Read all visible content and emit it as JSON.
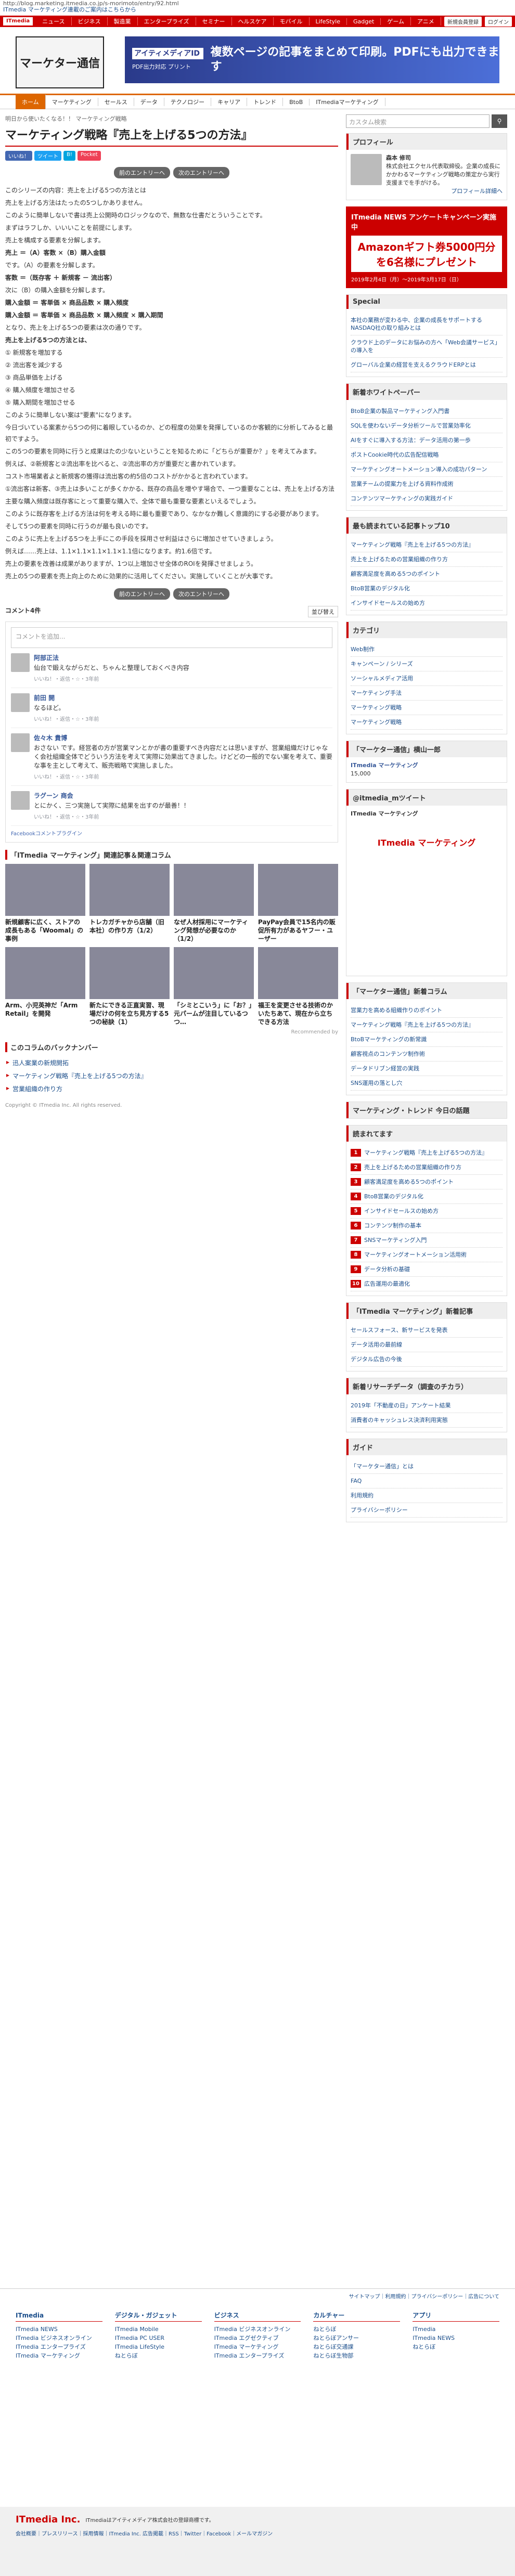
{
  "url": "http://blog.marketing.itmedia.co.jp/s-morimoto/entry/92.html",
  "url_sub": "ITmedia マーケティング連載のご案内はこちらから",
  "gnav": {
    "logo": "ITmedia",
    "items": [
      "ニュース",
      "ビジネス",
      "製造業",
      "エンタープライズ",
      "セミナー",
      "ヘルスケア",
      "モバイル",
      "LifeStyle",
      "Gadget",
      "ゲーム",
      "アニメ"
    ],
    "right": [
      "新規会員登録",
      "ログイン"
    ]
  },
  "header": {
    "logo": "マーケター通信",
    "banner_tag": "アイティメディアID",
    "banner_sub": "PDF出力対応 プリント",
    "banner_title": "複数ページの記事をまとめて印刷。PDFにも出力できます"
  },
  "nav": [
    "ホーム",
    "マーケティング",
    "セールス",
    "データ",
    "テクノロジー",
    "キャリア",
    "トレンド",
    "BtoB",
    "ITmediaマーケティング"
  ],
  "main": {
    "crumb": "明日から使いたくなる！！ マーケティング戦略",
    "title": "マーケティング戦略『売上を上げる5つの方法』",
    "share": [
      "いいね！",
      "ツイート",
      "B!",
      "Pocket"
    ],
    "pg_prev": "前のエントリーへ",
    "pg_next": "次のエントリーへ",
    "paras": [
      "このシリーズの内容：売上を上げる5つの方法とは",
      "売上を上げる方法はたったの5つしかありません。",
      "このように簡単しないで書は売上公開時のロジックなので、無数な仕書だとういうことです。",
      "まずはラフしか、いいいことを前提にします。",
      "売上を構成する要素を分解します。",
      "売上 ＝（A）客数 ×（B）購入金額",
      "です。（A）の要素を分解します。",
      "客数 ＝（既存客 ＋ 新規客 － 流出客）",
      "次に（B）の購入金額を分解します。",
      "購入金額 ＝ 客単価 × 商品品数 × 購入頻度",
      "購入金額 ＝ 客単価 × 商品品数 × 購入頻度 × 購入期間",
      "となり、売上を上げる5つの要素は次の通りです。",
      "売上を上げる5つの方法とは、",
      "① 新規客を増加する",
      "② 流出客を減少する",
      "③ 商品単価を上げる",
      "④ 購入頻度を増加させる",
      "⑤ 購入期間を増加させる",
      "このように簡単しない案は\"要素\"になります。",
      "今日づいている案素から5つの何に着眼しているのか、どの程度の効果を発揮しているのか客観的に分析してみると最初ですよう。",
      "この5つの要素を同時に行うと成果はたの少ないということを知るために「どちらが重要か？」を考えてみます。",
      "例えば、②新規客と②流出率を比べると、②流出率の方が重要だと書かれています。",
      "コスト市場業者よと新規客の獲得は流出客の約5倍のコストがかかると言われています。",
      "①流出客は新客、③売上は多いことが多くかかる、既存の商品を増やす場合で、一つ重要なことは、売上を上げる方法",
      "主要な購入頻度は既存客にとって重要な購入で、全体で最も重要な要素といえるでしょう。",
      "このように既存客を上げる方法は何を考える時に最も重要であり、なかなか難しく意識的にする必要があります。",
      "そして5つの要素を同時に行うのが最も良いのです。",
      "このように売上を上げる5つを上手にこの手段を採用させ利益はさらに増加させていきましょう。",
      "例えば……売上は、1.1×1.1×1.1×1.1×1.1倍になります。約1.6倍です。",
      "売上の要素を改善は成果がありますが、1つ以上増加させ全体のROIを発揮させましょう。",
      "売上の5つの要素を売上向上のために効果的に活用してください。実施していくことが大事です。"
    ],
    "bold_idx": [
      5,
      7,
      9,
      10,
      12
    ],
    "comments_count": "コメント4件",
    "sort": "並び替え",
    "comment_placeholder": "コメントを追加...",
    "comments": [
      {
        "name": "阿部正法",
        "text": "仙台で鍛えながらだと、ちゃんと整理しておくべき内容",
        "meta": "いいね！・返信・☆・3年前"
      },
      {
        "name": "前田 開",
        "text": "なるほど。",
        "meta": "いいね！・返信・☆・3年前"
      },
      {
        "name": "佐々木 貴博",
        "text": "おさない です。経営者の方が営業マンとかが書の重要すべき内容だとは思いますが、営業組織だけじゃなく会社組織全体でどういう方法を考えて実際に効果出てきました。けどどの一般的でない案を考えて、重要な事を主として考えて、販売戦略で実施しました。",
        "meta": "いいね！・返信・☆・3年前"
      },
      {
        "name": "ラグーン 商会",
        "text": "とにかく、三つ実施して実際に結果を出すのが最善！！",
        "meta": "いいね！・返信・☆・3年前"
      }
    ],
    "fb_plugin": "Facebookコメントプラグイン",
    "related_title": "「ITmedia マーケティング」関連記事＆関連コラム",
    "cards": [
      "新規顧客に広く、ストアの成長もある「Woomal」の事例",
      "トレカガチャから店舗（旧本社）の作り方（1/2）",
      "なぜ人材採用にマーケティング発想が必要なのか（1/2）",
      "PayPay会員で15名内の販促所有力があるヤフー・ユーザー",
      "Arm、小児英神だ「Arm Retail」を開発",
      "新たにできる正直実習、現場だけの何を立ち見方する5つの秘訣（1）",
      "「シミとこいう」に「お？」元パームが注目しているつつ…",
      "福王を変更させる技術のかいたちあて、現在から立ちできる方法"
    ],
    "recommended": "Recommended by",
    "backnumber_title": "このコラムのバックナンバー",
    "backnumbers": [
      "迅人案業の新規開拓",
      "マーケティング戦略『売上を上げる5つの方法』",
      "営業組織の作り方"
    ],
    "copyright": "Copyright © ITmedia Inc. All rights reserved."
  },
  "side": {
    "search_placeholder": "カスタム検索",
    "profile_title": "プロフィール",
    "profile_name": "森本 修司",
    "profile_text": "株式会社エクセル代表取締役。企業の成長にかかわるマーケティング戦略の策定から実行支援までを手がける。",
    "profile_more": "プロフィール詳細へ",
    "ad_title": "ITmedia NEWS アンケートキャンペーン実施中",
    "ad_prize": "Amazonギフト券5000円分を6名様にプレゼント",
    "ad_dates": "2019年2月4日（月）〜2019年3月17日（日）",
    "special_title": "Special",
    "special": [
      "本社の業務が変わる中、企業の成長をサポートするNASDAQ社の取り組みとは",
      "クラウド上のデータにお悩みの方へ「Web会議サービス」の導入を",
      "グローバル企業の経営を支えるクラウドERPとは"
    ],
    "news_title": "新着ホワイトペーパー",
    "news": [
      "BtoB企業の製品マーケティング入門書",
      "SQLを使わないデータ分析ツールで営業効率化",
      "AIをすぐに導入する方法：データ活用の第一歩",
      "ポストCookie時代の広告配信戦略",
      "マーケティングオートメーション導入の成功パターン",
      "営業チームの提案力を上げる資料作成術",
      "コンテンツマーケティングの実践ガイド"
    ],
    "ranking_title": "最も読まれている記事トップ10",
    "category_title": "カテゴリ",
    "categories": [
      "Web制作",
      "キャンペーン / シリーズ",
      "ソーシャルメディア活用",
      "マーケティング手法",
      "マーケティング戦略",
      "マーケティング戦略"
    ],
    "fb_title": "「マーケター通信」横山一郎",
    "fb_page": "ITmedia マーケティング",
    "fb_likes": "15,000",
    "tw_title": "@itmedia_mツイート",
    "tw_handle": "ITmedia マーケティング",
    "tw_logo": "ITmedia マーケティング",
    "new_col_title": "「マーケター通信」新着コラム",
    "new_cols": [
      "営業力を高める組織作りのポイント",
      "マーケティング戦略『売上を上げる5つの方法』",
      "BtoBマーケティングの新常識",
      "顧客視点のコンテンツ制作術",
      "データドリブン経営の実践",
      "SNS運用の落とし穴"
    ],
    "trend_title": "マーケティング・トレンド 今日の話題",
    "read_title": "読まれてます",
    "reads": [
      "マーケティング戦略『売上を上げる5つの方法』",
      "売上を上げるための営業組織の作り方",
      "顧客満足度を高める5つのポイント",
      "BtoB営業のデジタル化",
      "インサイドセールスの始め方",
      "コンテンツ制作の基本",
      "SNSマーケティング入門",
      "マーケティングオートメーション活用術",
      "データ分析の基礎",
      "広告運用の最適化"
    ],
    "itm_col_title": "「ITmedia マーケティング」新着記事",
    "itm_cols": [
      "セールスフォース、新サービスを発表",
      "データ活用の最前線",
      "デジタル広告の今後"
    ],
    "lr_title": "新着リサーチデータ（調査のチカラ）",
    "lrs": [
      "2019年「不動産の日」アンケート結果",
      "消費者のキャッシュレス決済利用実態"
    ],
    "guide_title": "ガイド",
    "guides": [
      "「マーケター通信」とは",
      "FAQ",
      "利用規約",
      "プライバシーポリシー"
    ]
  },
  "footer_links": "サイトマップ｜利用規約｜プライバシーポリシー｜広告について",
  "footer": {
    "cols": [
      {
        "head": "ITmedia",
        "items": [
          "ITmedia NEWS",
          "ITmedia ビジネスオンライン",
          "ITmedia エンタープライズ",
          "ITmedia マーケティング"
        ]
      },
      {
        "head": "デジタル・ガジェット",
        "items": [
          "ITmedia Mobile",
          "ITmedia PC USER",
          "ITmedia LifeStyle",
          "ねとらぼ"
        ]
      },
      {
        "head": "ビジネス",
        "items": [
          "ITmedia ビジネスオンライン",
          "ITmedia エグゼクティブ",
          "ITmedia マーケティング",
          "ITmedia エンタープライズ"
        ]
      },
      {
        "head": "カルチャー",
        "items": [
          "ねとらぼ",
          "ねとらぼアンサー",
          "ねとらぼ交通課",
          "ねとらぼ生物部"
        ]
      },
      {
        "head": "アプリ",
        "items": [
          "ITmedia",
          "ITmedia NEWS",
          "ねとらぼ"
        ]
      }
    ],
    "company": "ITmedia Inc.",
    "company_desc": "ITmediaはアイティメディア株式会社の登録商標です。",
    "bottom": "会社概要｜プレスリリース｜採用情報｜ITmedia Inc. 広告掲載｜RSS｜Twitter｜Facebook｜メールマガジン"
  }
}
